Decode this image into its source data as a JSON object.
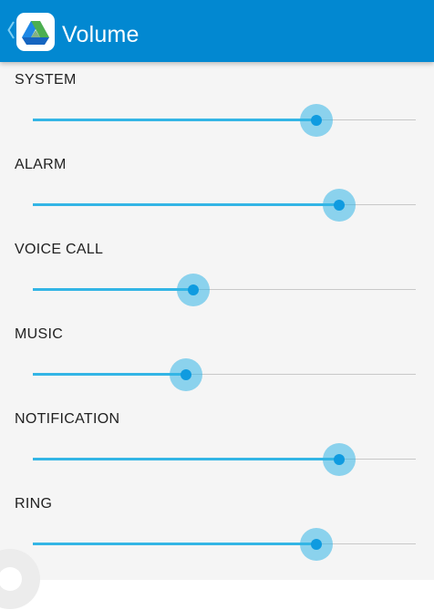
{
  "header": {
    "title": "Volume",
    "background": "#0288d1",
    "icons": [
      "back-chevron-icon",
      "app-logo-icon"
    ]
  },
  "accent": "#33b5e5",
  "volumes": [
    {
      "key": "system",
      "label": "SYSTEM",
      "level": 0.74
    },
    {
      "key": "alarm",
      "label": "ALARM",
      "level": 0.8
    },
    {
      "key": "voice-call",
      "label": "VOICE CALL",
      "level": 0.42
    },
    {
      "key": "music",
      "label": "MUSIC",
      "level": 0.4
    },
    {
      "key": "notification",
      "label": "NOTIFICATION",
      "level": 0.8
    },
    {
      "key": "ring",
      "label": "RING",
      "level": 0.74
    }
  ],
  "overlay": {
    "icon": "floating-assist-ring-icon"
  }
}
